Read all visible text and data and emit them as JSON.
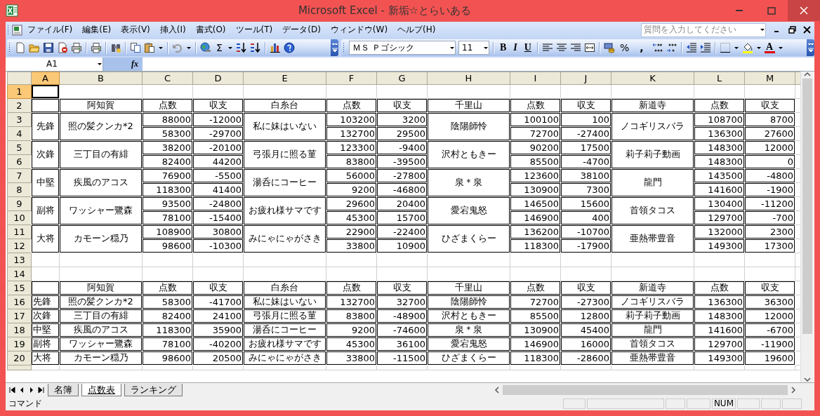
{
  "window": {
    "title": "Microsoft Excel - 新垢☆とらいある"
  },
  "menu": [
    {
      "label": "ファイル(F)"
    },
    {
      "label": "編集(E)"
    },
    {
      "label": "表示(V)"
    },
    {
      "label": "挿入(I)"
    },
    {
      "label": "書式(O)"
    },
    {
      "label": "ツール(T)"
    },
    {
      "label": "データ(D)"
    },
    {
      "label": "ウィンドウ(W)"
    },
    {
      "label": "ヘルプ(H)"
    }
  ],
  "help_search": {
    "placeholder": "質問を入力してください"
  },
  "standard_toolbar": {
    "autosum": "Σ"
  },
  "formatting_toolbar": {
    "font": "ＭＳ Ｐゴシック",
    "size": "11",
    "bold": "B",
    "italic": "I",
    "underline": "U",
    "percent": "%",
    "comma": ",",
    "font_color": "A"
  },
  "formula_bar": {
    "name_box": "A1",
    "function_label": "fx"
  },
  "sheet": {
    "columns": [
      {
        "label": "A",
        "selected": true
      },
      {
        "label": "B",
        "selected": false
      },
      {
        "label": "C",
        "selected": false
      },
      {
        "label": "D",
        "selected": false
      },
      {
        "label": "E",
        "selected": false
      },
      {
        "label": "F",
        "selected": false
      },
      {
        "label": "G",
        "selected": false
      },
      {
        "label": "H",
        "selected": false
      },
      {
        "label": "I",
        "selected": false
      },
      {
        "label": "J",
        "selected": false
      },
      {
        "label": "K",
        "selected": false
      },
      {
        "label": "L",
        "selected": false
      },
      {
        "label": "M",
        "selected": false
      }
    ],
    "rows": [
      {
        "label": "1",
        "selected": true
      },
      {
        "label": "2",
        "selected": false
      },
      {
        "label": "3",
        "selected": false
      },
      {
        "label": "4",
        "selected": false
      },
      {
        "label": "5",
        "selected": false
      },
      {
        "label": "6",
        "selected": false
      },
      {
        "label": "7",
        "selected": false
      },
      {
        "label": "8",
        "selected": false
      },
      {
        "label": "9",
        "selected": false
      },
      {
        "label": "10",
        "selected": false
      },
      {
        "label": "11",
        "selected": false
      },
      {
        "label": "12",
        "selected": false
      },
      {
        "label": "13",
        "selected": false
      },
      {
        "label": "14",
        "selected": false
      },
      {
        "label": "15",
        "selected": false
      },
      {
        "label": "16",
        "selected": false
      },
      {
        "label": "17",
        "selected": false
      },
      {
        "label": "18",
        "selected": false
      },
      {
        "label": "19",
        "selected": false
      },
      {
        "label": "20",
        "selected": false
      }
    ],
    "upper_table": {
      "schools": [
        {
          "name": "阿知賀",
          "score_label": "点数",
          "balance_label": "収支"
        },
        {
          "name": "白糸台",
          "score_label": "点数",
          "balance_label": "収支"
        },
        {
          "name": "千里山",
          "score_label": "点数",
          "balance_label": "収支"
        },
        {
          "name": "新道寺",
          "score_label": "点数",
          "balance_label": "収支"
        }
      ],
      "rows": [
        {
          "position": "先鋒",
          "players": [
            {
              "name": "照の髪クンカ*2",
              "games": [
                [
                  "88000",
                  "-12000"
                ],
                [
                  "58300",
                  "-29700"
                ]
              ]
            },
            {
              "name": "私に妹はいない",
              "games": [
                [
                  "103200",
                  "3200"
                ],
                [
                  "132700",
                  "29500"
                ]
              ]
            },
            {
              "name": "陰陽師怜",
              "games": [
                [
                  "100100",
                  "100"
                ],
                [
                  "72700",
                  "-27400"
                ]
              ]
            },
            {
              "name": "ノコギリスバラ",
              "games": [
                [
                  "108700",
                  "8700"
                ],
                [
                  "136300",
                  "27600"
                ]
              ]
            }
          ]
        },
        {
          "position": "次鋒",
          "players": [
            {
              "name": "三丁目の有緋",
              "games": [
                [
                  "38200",
                  "-20100"
                ],
                [
                  "82400",
                  "44200"
                ]
              ]
            },
            {
              "name": "弓張月に照る菫",
              "games": [
                [
                  "123300",
                  "-9400"
                ],
                [
                  "83800",
                  "-39500"
                ]
              ]
            },
            {
              "name": "沢村ともきー",
              "games": [
                [
                  "90200",
                  "17500"
                ],
                [
                  "85500",
                  "-4700"
                ]
              ]
            },
            {
              "name": "莉子莉子動画",
              "games": [
                [
                  "148300",
                  "12000"
                ],
                [
                  "148300",
                  "0"
                ]
              ]
            }
          ]
        },
        {
          "position": "中堅",
          "players": [
            {
              "name": "疾風のアコス",
              "games": [
                [
                  "76900",
                  "-5500"
                ],
                [
                  "118300",
                  "41400"
                ]
              ]
            },
            {
              "name": "湯呑にコーヒー",
              "games": [
                [
                  "56000",
                  "-27800"
                ],
                [
                  "9200",
                  "-46800"
                ]
              ]
            },
            {
              "name": "泉＊泉",
              "games": [
                [
                  "123600",
                  "38100"
                ],
                [
                  "130900",
                  "7300"
                ]
              ]
            },
            {
              "name": "龍門",
              "games": [
                [
                  "143500",
                  "-4800"
                ],
                [
                  "141600",
                  "-1900"
                ]
              ]
            }
          ]
        },
        {
          "position": "副将",
          "players": [
            {
              "name": "ワッシャー鷺森",
              "games": [
                [
                  "93500",
                  "-24800"
                ],
                [
                  "78100",
                  "-15400"
                ]
              ]
            },
            {
              "name": "お疲れ様サマです",
              "games": [
                [
                  "29600",
                  "20400"
                ],
                [
                  "45300",
                  "15700"
                ]
              ]
            },
            {
              "name": "愛宕鬼怒",
              "games": [
                [
                  "146500",
                  "15600"
                ],
                [
                  "146900",
                  "400"
                ]
              ]
            },
            {
              "name": "首領タコス",
              "games": [
                [
                  "130400",
                  "-11200"
                ],
                [
                  "129700",
                  "-700"
                ]
              ]
            }
          ]
        },
        {
          "position": "大将",
          "players": [
            {
              "name": "カモーン穏乃",
              "games": [
                [
                  "108900",
                  "30800"
                ],
                [
                  "98600",
                  "-10300"
                ]
              ]
            },
            {
              "name": "みにゃにゃがさき",
              "games": [
                [
                  "22900",
                  "-22400"
                ],
                [
                  "33800",
                  "10900"
                ]
              ]
            },
            {
              "name": "ひざまくらー",
              "games": [
                [
                  "136200",
                  "-10700"
                ],
                [
                  "118300",
                  "-17900"
                ]
              ]
            },
            {
              "name": "亜熱帯豊音",
              "games": [
                [
                  "132000",
                  "2300"
                ],
                [
                  "149300",
                  "17300"
                ]
              ]
            }
          ]
        }
      ]
    },
    "lower_table": {
      "schools": [
        {
          "name": "阿知賀",
          "score_label": "点数",
          "balance_label": "収支"
        },
        {
          "name": "白糸台",
          "score_label": "点数",
          "balance_label": "収支"
        },
        {
          "name": "千里山",
          "score_label": "点数",
          "balance_label": "収支"
        },
        {
          "name": "新道寺",
          "score_label": "点数",
          "balance_label": "収支"
        }
      ],
      "rows": [
        {
          "position": "先鋒",
          "players": [
            {
              "name": "照の髪クンカ*2",
              "score": "58300",
              "balance": "-41700"
            },
            {
              "name": "私に妹はいない",
              "score": "132700",
              "balance": "32700"
            },
            {
              "name": "陰陽師怜",
              "score": "72700",
              "balance": "-27300"
            },
            {
              "name": "ノコギリスバラ",
              "score": "136300",
              "balance": "36300"
            }
          ]
        },
        {
          "position": "次鋒",
          "players": [
            {
              "name": "三丁目の有緋",
              "score": "82400",
              "balance": "24100"
            },
            {
              "name": "弓張月に照る菫",
              "score": "83800",
              "balance": "-48900"
            },
            {
              "name": "沢村ともきー",
              "score": "85500",
              "balance": "12800"
            },
            {
              "name": "莉子莉子動画",
              "score": "148300",
              "balance": "12000"
            }
          ]
        },
        {
          "position": "中堅",
          "players": [
            {
              "name": "疾風のアコス",
              "score": "118300",
              "balance": "35900"
            },
            {
              "name": "湯呑にコーヒー",
              "score": "9200",
              "balance": "-74600"
            },
            {
              "name": "泉＊泉",
              "score": "130900",
              "balance": "45400"
            },
            {
              "name": "龍門",
              "score": "141600",
              "balance": "-6700"
            }
          ]
        },
        {
          "position": "副将",
          "players": [
            {
              "name": "ワッシャー鷺森",
              "score": "78100",
              "balance": "-40200"
            },
            {
              "name": "お疲れ様サマです",
              "score": "45300",
              "balance": "36100"
            },
            {
              "name": "愛宕鬼怒",
              "score": "146900",
              "balance": "16000"
            },
            {
              "name": "首領タコス",
              "score": "129700",
              "balance": "-11900"
            }
          ]
        },
        {
          "position": "大将",
          "players": [
            {
              "name": "カモーン穏乃",
              "score": "98600",
              "balance": "20500"
            },
            {
              "name": "みにゃにゃがさき",
              "score": "33800",
              "balance": "-11500"
            },
            {
              "name": "ひざまくらー",
              "score": "118300",
              "balance": "-28600"
            },
            {
              "name": "亜熱帯豊音",
              "score": "149300",
              "balance": "19600"
            }
          ]
        }
      ]
    }
  },
  "sheet_tabs": [
    {
      "label": "名簿",
      "selected": false
    },
    {
      "label": "点数表",
      "selected": true
    },
    {
      "label": "ランキング",
      "selected": false
    }
  ],
  "status_bar": {
    "mode": "コマンド",
    "num_lock": "NUM"
  }
}
